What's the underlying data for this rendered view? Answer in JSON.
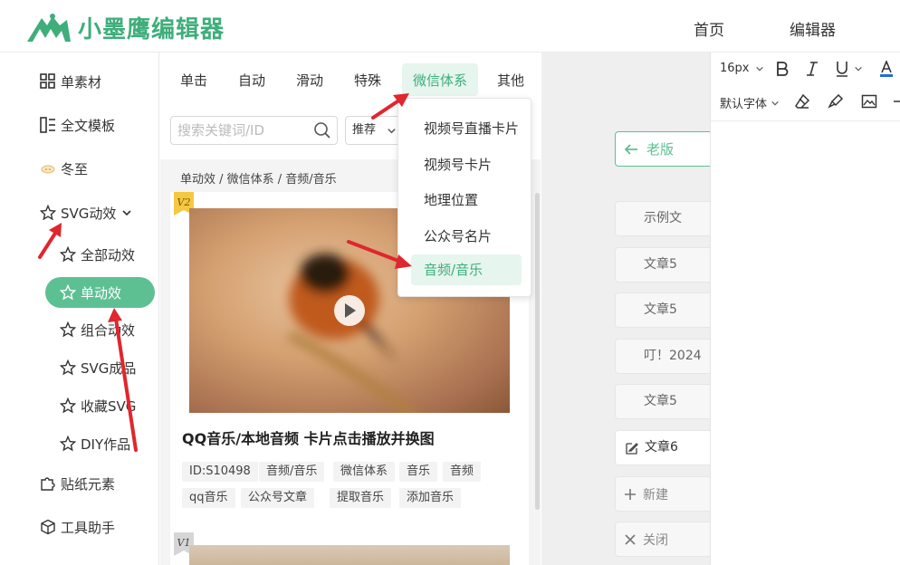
{
  "header": {
    "logo_text": "小墨鹰编辑器",
    "nav": [
      "首页",
      "编辑器"
    ]
  },
  "sidebar": {
    "items": [
      {
        "label": "单素材",
        "icon": "grid-icon"
      },
      {
        "label": "全文模板",
        "icon": "layout-icon"
      },
      {
        "label": "冬至",
        "icon": "dumpling-icon"
      },
      {
        "label": "SVG动效",
        "icon": "star-icon",
        "chevron": "chevron-down-icon"
      }
    ],
    "sub_items": [
      {
        "label": "全部动效",
        "icon": "star-icon"
      },
      {
        "label": "单动效",
        "icon": "star-icon",
        "active": true
      },
      {
        "label": "组合动效",
        "icon": "star-n-icon"
      },
      {
        "label": "SVG成品",
        "icon": "star-icon"
      },
      {
        "label": "收藏SVG",
        "icon": "star-icon"
      },
      {
        "label": "DIY作品",
        "icon": "star-edit-icon"
      }
    ],
    "bottom_items": [
      {
        "label": "贴纸元素",
        "icon": "puzzle-icon"
      },
      {
        "label": "工具助手",
        "icon": "cube-icon"
      }
    ]
  },
  "content": {
    "tabs": [
      "单击",
      "自动",
      "滑动",
      "特殊",
      "微信体系",
      "其他"
    ],
    "active_tab": "微信体系",
    "search": {
      "placeholder": "搜索关键词/ID",
      "value": ""
    },
    "sort": {
      "selected": "推荐"
    },
    "breadcrumb": "单动效 / 微信体系 / 音频/音乐",
    "card": {
      "version_badge": "V2",
      "title": "QQ音乐/本地音频 卡片点击播放并换图",
      "tags": [
        "ID:S10498",
        "音频/音乐",
        "微信体系",
        "音乐",
        "音频",
        "qq音乐",
        "公众号文章",
        "提取音乐",
        "添加音乐"
      ]
    },
    "card2": {
      "version_badge": "V1"
    }
  },
  "dropdown": {
    "items": [
      "视频号直播卡片",
      "视频号卡片",
      "地理位置",
      "公众号名片",
      "音频/音乐"
    ],
    "active": "音频/音乐"
  },
  "doclist": {
    "old_version_button": "老版",
    "items": [
      "示例文",
      "文章5",
      "文章5",
      "叮！2024",
      "文章5"
    ],
    "active_item": "文章6",
    "new_button": "新建",
    "close_button": "关闭"
  },
  "editor": {
    "font_size": "16px",
    "font_family": "默认字体",
    "accent_color": "#3fae7a"
  }
}
